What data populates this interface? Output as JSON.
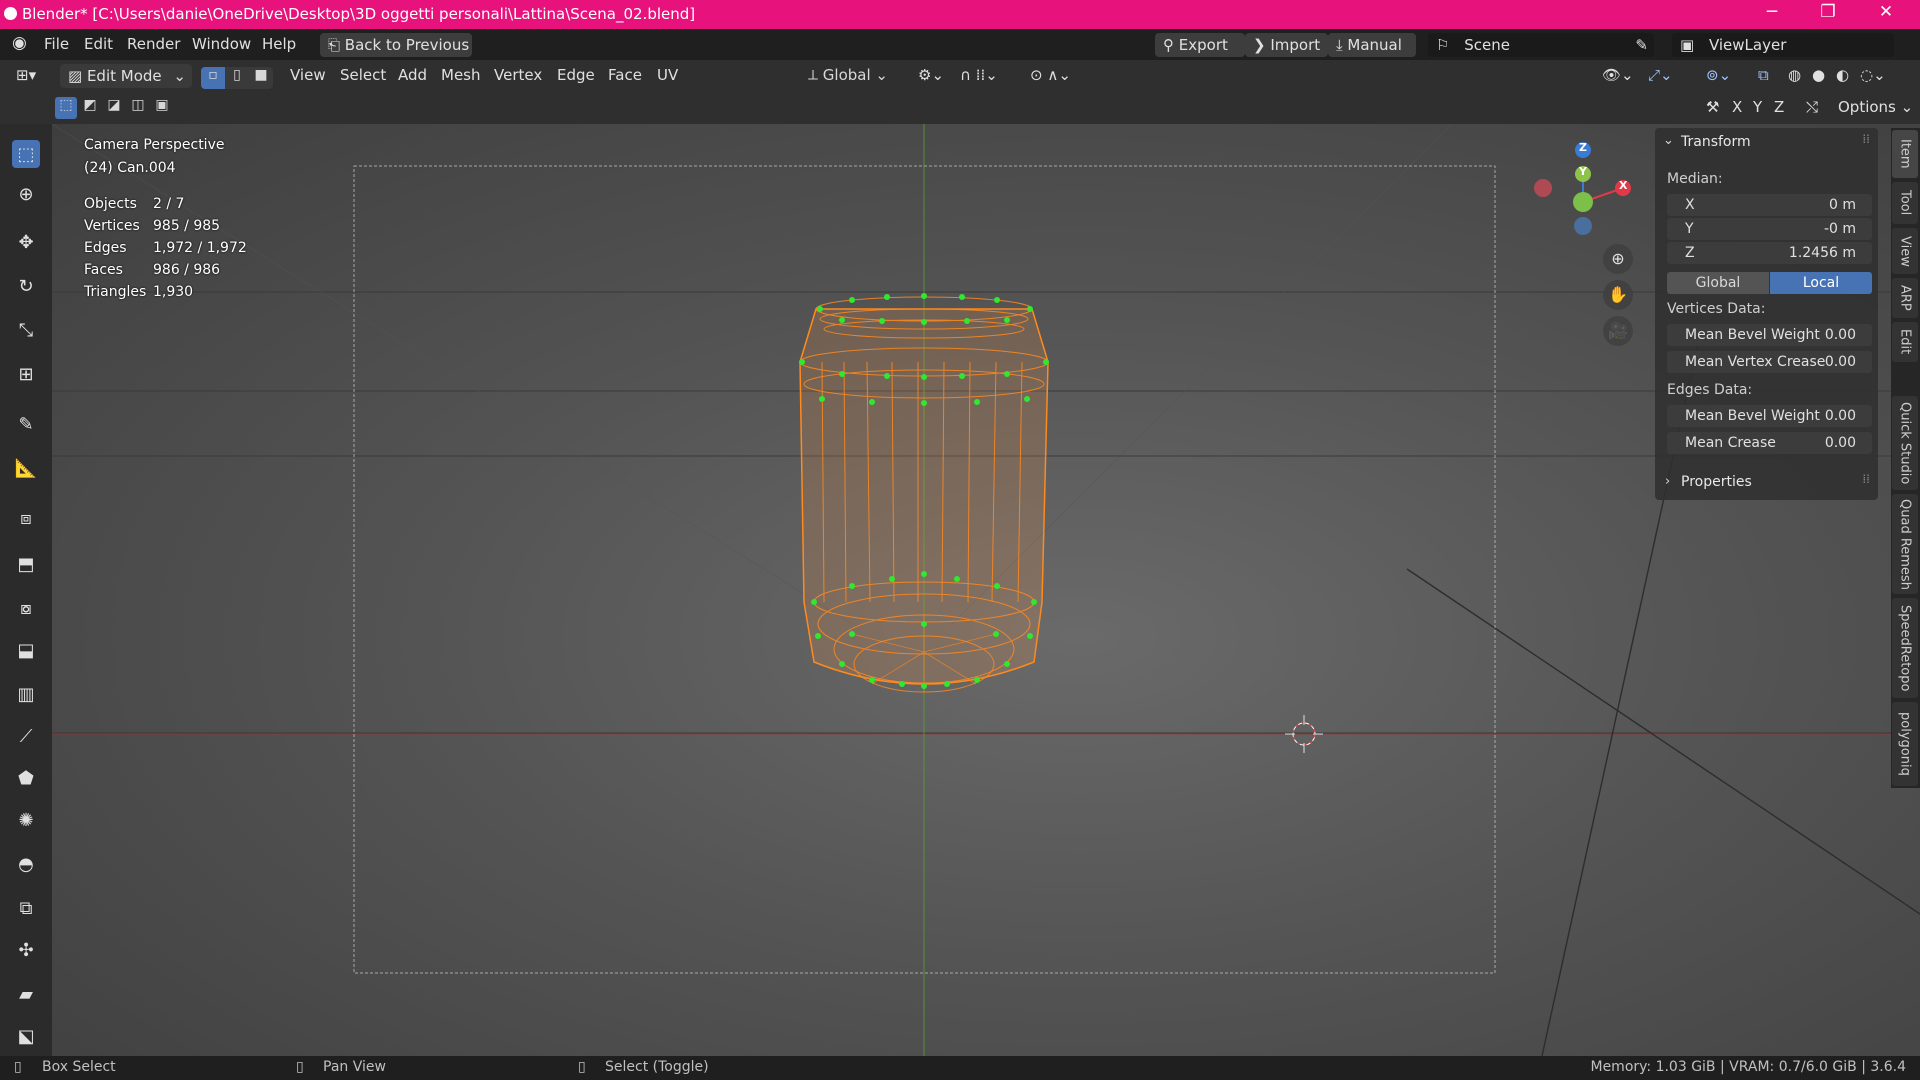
{
  "titlebar": {
    "title": "Blender* [C:\\Users\\danie\\OneDrive\\Desktop\\3D oggetti personali\\Lattina\\Scena_02.blend]",
    "minimize": "─",
    "maximize": "❐",
    "close": "✕"
  },
  "menu": {
    "items": [
      "File",
      "Edit",
      "Render",
      "Window",
      "Help"
    ],
    "back_label": "Back to Previous",
    "export": "Export",
    "import": "Import",
    "manual": "Manual",
    "scene": "Scene",
    "viewlayer": "ViewLayer"
  },
  "header": {
    "mode": "Edit Mode",
    "menus": [
      "View",
      "Select",
      "Add",
      "Mesh",
      "Vertex",
      "Edge",
      "Face",
      "UV"
    ],
    "orientation": "Global",
    "axes": [
      "X",
      "Y",
      "Z"
    ],
    "options": "Options"
  },
  "overlay": {
    "view_name": "Camera Perspective",
    "object_name": "(24) Can.004",
    "stats": [
      {
        "label": "Objects",
        "value": "2 / 7"
      },
      {
        "label": "Vertices",
        "value": "985 / 985"
      },
      {
        "label": "Edges",
        "value": "1,972 / 1,972"
      },
      {
        "label": "Faces",
        "value": "986 / 986"
      },
      {
        "label": "Triangles",
        "value": "1,930"
      }
    ]
  },
  "npanel": {
    "transform_title": "Transform",
    "median_label": "Median:",
    "x": {
      "label": "X",
      "value": "0 m"
    },
    "y": {
      "label": "Y",
      "value": "-0 m"
    },
    "z": {
      "label": "Z",
      "value": "1.2456 m"
    },
    "global": "Global",
    "local": "Local",
    "vertices_data": "Vertices Data:",
    "mean_bevel_weight_v": {
      "label": "Mean Bevel Weight",
      "value": "0.00"
    },
    "mean_vertex_crease": {
      "label": "Mean Vertex Crease",
      "value": "0.00"
    },
    "edges_data": "Edges Data:",
    "mean_bevel_weight_e": {
      "label": "Mean Bevel Weight",
      "value": "0.00"
    },
    "mean_crease": {
      "label": "Mean Crease",
      "value": "0.00"
    },
    "properties": "Properties"
  },
  "sidetabs": [
    "Item",
    "Tool",
    "View",
    "ARP",
    "Edit",
    "Quick Studio",
    "Quad Remesh",
    "SpeedRetopo",
    "polygoniq"
  ],
  "gizmo": {
    "z": "Z",
    "y": "Y",
    "x": "X"
  },
  "status": {
    "left": "Box Select",
    "middle": "Pan View",
    "right": "Select (Toggle)",
    "memory": "Memory: 1.03 GiB | VRAM: 0.7/6.0 GiB | 3.6.4"
  },
  "colors": {
    "title_bar": "#e8127c",
    "accent": "#4772b3",
    "wire": "#ff8a1f",
    "vertex": "#2fe82f"
  }
}
